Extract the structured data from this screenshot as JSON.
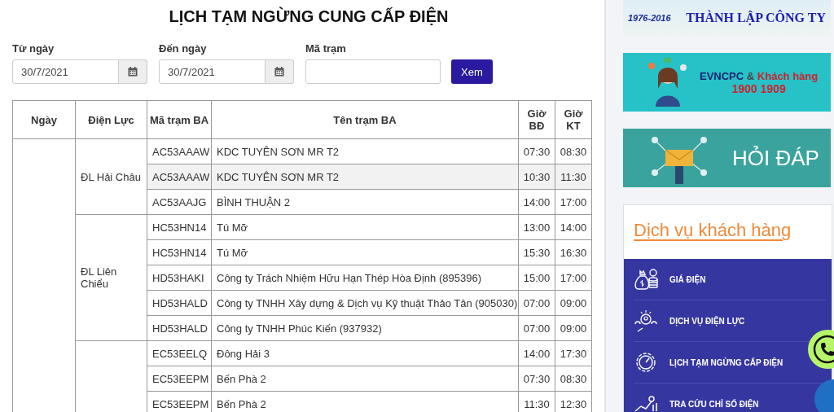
{
  "title": "LỊCH TẠM NGỪNG CUNG CẤP ĐIỆN",
  "filters": {
    "from": {
      "label": "Từ ngày",
      "value": "30/7/2021"
    },
    "to": {
      "label": "Đến ngày",
      "value": "30/7/2021"
    },
    "station": {
      "label": "Mã trạm"
    },
    "button": "Xem"
  },
  "table": {
    "columns": [
      "Ngày",
      "Điện Lực",
      "Mã trạm BA",
      "Tên trạm BA",
      "Giờ BĐ",
      "Giờ KT"
    ],
    "groups": [
      {
        "district": "ĐL Hải Châu",
        "rows": [
          {
            "code": "AC53AAAW",
            "name": "KDC TUYÊN SƠN MR T2",
            "start": "07:30",
            "end": "08:30",
            "highlighted": false
          },
          {
            "code": "AC53AAAW",
            "name": "KDC TUYÊN SƠN MR T2",
            "start": "10:30",
            "end": "11:30",
            "highlighted": true
          },
          {
            "code": "AC53AAJG",
            "name": "BÌNH THUẬN 2",
            "start": "14:00",
            "end": "17:00",
            "highlighted": false
          }
        ]
      },
      {
        "district": "ĐL Liên Chiểu",
        "rows": [
          {
            "code": "HC53HN14",
            "name": "Tú Mỡ",
            "start": "13:00",
            "end": "14:00",
            "highlighted": false
          },
          {
            "code": "HC53HN14",
            "name": "Tú Mỡ",
            "start": "15:30",
            "end": "16:30",
            "highlighted": false
          },
          {
            "code": "HD53HAKI",
            "name": "Công ty Trách Nhiệm Hữu Hạn Thép Hòa Định (895396)",
            "start": "15:00",
            "end": "17:00",
            "highlighted": false
          },
          {
            "code": "HD53HALD",
            "name": "Công ty TNHH Xây dựng & Dịch vụ Kỹ thuật Thảo Tân (905030)",
            "start": "07:00",
            "end": "09:00",
            "highlighted": false
          },
          {
            "code": "HD53HALD",
            "name": "Công ty TNHH Phúc Kiến (937932)",
            "start": "07:00",
            "end": "09:00",
            "highlighted": false
          }
        ]
      },
      {
        "rows": [
          {
            "code": "EC53EELQ",
            "name": "Đông Hải 3",
            "start": "14:00",
            "end": "17:30",
            "highlighted": false
          },
          {
            "code": "EC53EEPM",
            "name": "Bến Phà 2",
            "start": "07:30",
            "end": "08:30",
            "highlighted": false
          },
          {
            "code": "EC53EEPM",
            "name": "Bến Phà 2",
            "start": "11:30",
            "end": "12:30",
            "highlighted": false
          }
        ]
      }
    ]
  },
  "sidebar": {
    "banners": [
      {
        "kind": "anniversary",
        "years": "1976-2016",
        "text": "THÀNH LẬP CÔNG TY"
      },
      {
        "kind": "hotline",
        "brand": "EVNCPC",
        "amp": "&",
        "customer": "Khách hàng",
        "phone": "1900 1909"
      },
      {
        "kind": "faq",
        "text": "HỎI ĐÁP"
      }
    ],
    "services": {
      "title": "Dịch vụ khách hàng",
      "items": [
        {
          "kind": "price",
          "label": "GIÁ ĐIỆN"
        },
        {
          "kind": "service",
          "label": "DỊCH VỤ ĐIỆN LỰC"
        },
        {
          "kind": "schedule",
          "label": "LỊCH TẠM NGỪNG CẤP ĐIỆN"
        },
        {
          "kind": "meter",
          "label": "TRA CỨU CHỈ SỐ ĐIỆN"
        }
      ]
    }
  }
}
